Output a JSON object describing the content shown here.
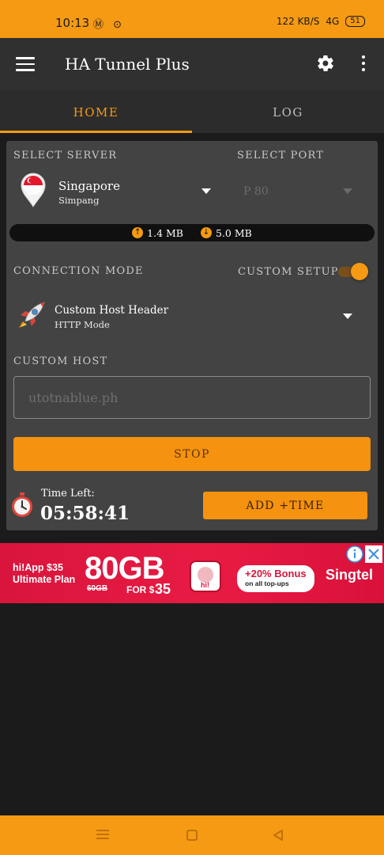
{
  "status_bar": {
    "time": "10:13",
    "left_icons": "Ⓜ ⊙",
    "net_speed": "122 KB/S",
    "signal": "4G",
    "battery": "51"
  },
  "app_bar": {
    "title": "HA Tunnel Plus"
  },
  "tabs": [
    {
      "label": "HOME",
      "active": true
    },
    {
      "label": "LOG",
      "active": false
    }
  ],
  "server": {
    "select_server_label": "SELECT SERVER",
    "select_port_label": "SELECT PORT",
    "name": "Singapore",
    "location": "Simpang",
    "port": "P 80"
  },
  "data_usage": {
    "upload": "1.4 MB",
    "download": "5.0 MB"
  },
  "connection": {
    "mode_label": "CONNECTION MODE",
    "custom_setup_label": "CUSTOM SETUP",
    "custom_setup_enabled": true,
    "mode_name": "Custom Host Header",
    "mode_sub": "HTTP Mode"
  },
  "custom_host": {
    "label": "CUSTOM HOST",
    "placeholder": "utotnablue.ph",
    "value": ""
  },
  "actions": {
    "stop_label": "STOP",
    "time_left_label": "Time Left:",
    "time_left_value": "05:58:41",
    "add_time_label": "ADD +TIME"
  },
  "ad": {
    "plan": "hi!App $35 Ultimate Plan",
    "data": "80GB",
    "old_data": "60GB",
    "price_prefix": "FOR $",
    "price": "35",
    "app_label": "hi!",
    "bonus": "+20% Bonus",
    "bonus_sub": "on all top-ups",
    "brand": "Singtel"
  },
  "colors": {
    "accent": "#f59a12",
    "card": "#434343",
    "background": "#1b1b1b"
  }
}
